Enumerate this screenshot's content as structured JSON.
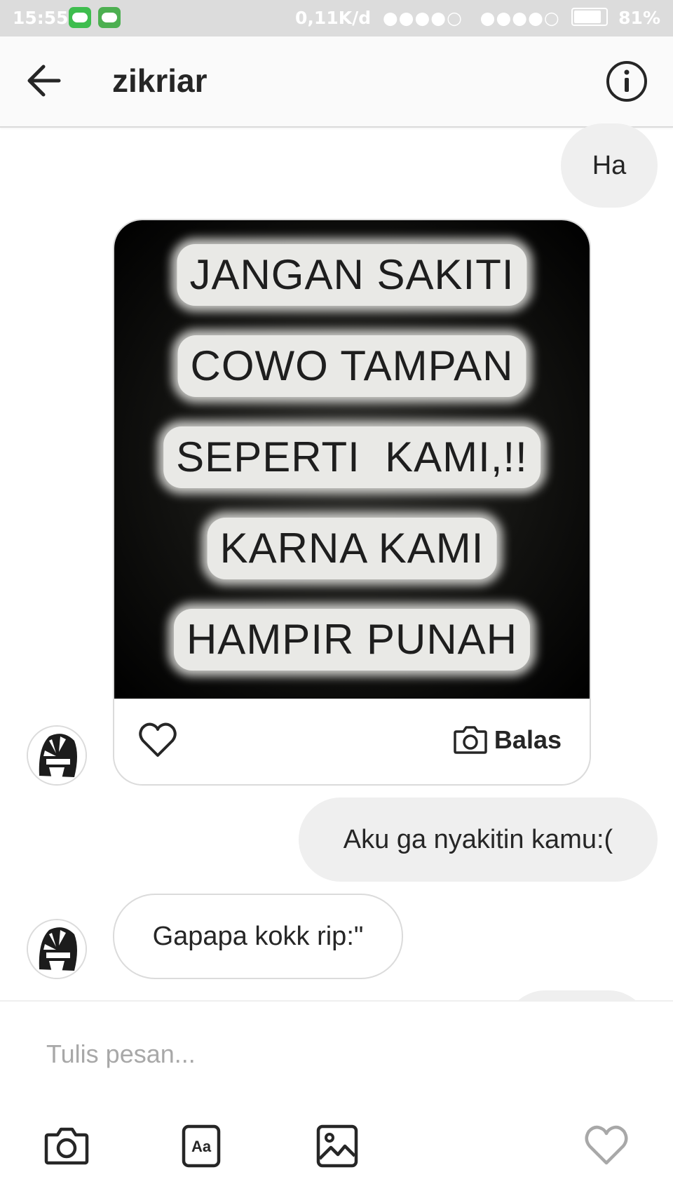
{
  "status_bar": {
    "time": "15:55",
    "network_speed": "0,11K/d",
    "signal1": "●●●●○",
    "signal2": "●●●●○",
    "battery": "81%"
  },
  "header": {
    "title": "zikriar",
    "back_icon": "arrow-left-icon",
    "info_icon": "info-icon"
  },
  "messages": [
    {
      "side": "right",
      "type": "text",
      "text": "Ha"
    },
    {
      "side": "left",
      "type": "media",
      "image_text": [
        "JANGAN SAKITI",
        "COWO TAMPAN",
        "SEPERTI  KAMI,!!",
        "KARNA KAMI",
        "HAMPIR PUNAH"
      ],
      "reply_label": "Balas"
    },
    {
      "side": "right",
      "type": "text",
      "text": "Aku ga nyakitin kamu:("
    },
    {
      "side": "left",
      "type": "text",
      "text": "Gapapa kokk rip:\""
    }
  ],
  "composer": {
    "placeholder": "Tulis pesan...",
    "tools": [
      "camera-icon",
      "text-style-icon",
      "gallery-icon",
      "heart-icon"
    ]
  },
  "colors": {
    "bubble_gray": "#efefef",
    "border": "#dbdbdb",
    "text": "#262626",
    "placeholder": "#a8a8a8"
  }
}
